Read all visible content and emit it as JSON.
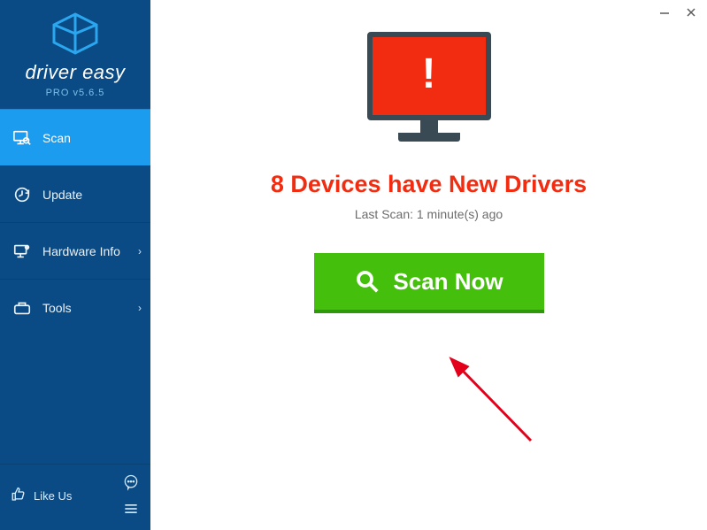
{
  "window": {
    "minimize": "–",
    "close": "×"
  },
  "brand": {
    "name": "driver easy",
    "sub": "PRO v5.6.5"
  },
  "sidebar": {
    "items": [
      {
        "label": "Scan"
      },
      {
        "label": "Update"
      },
      {
        "label": "Hardware Info"
      },
      {
        "label": "Tools"
      }
    ],
    "like": "Like Us"
  },
  "main": {
    "headline": "8 Devices have New Drivers",
    "subline": "Last Scan: 1 minute(s) ago",
    "scan_button": "Scan Now"
  }
}
